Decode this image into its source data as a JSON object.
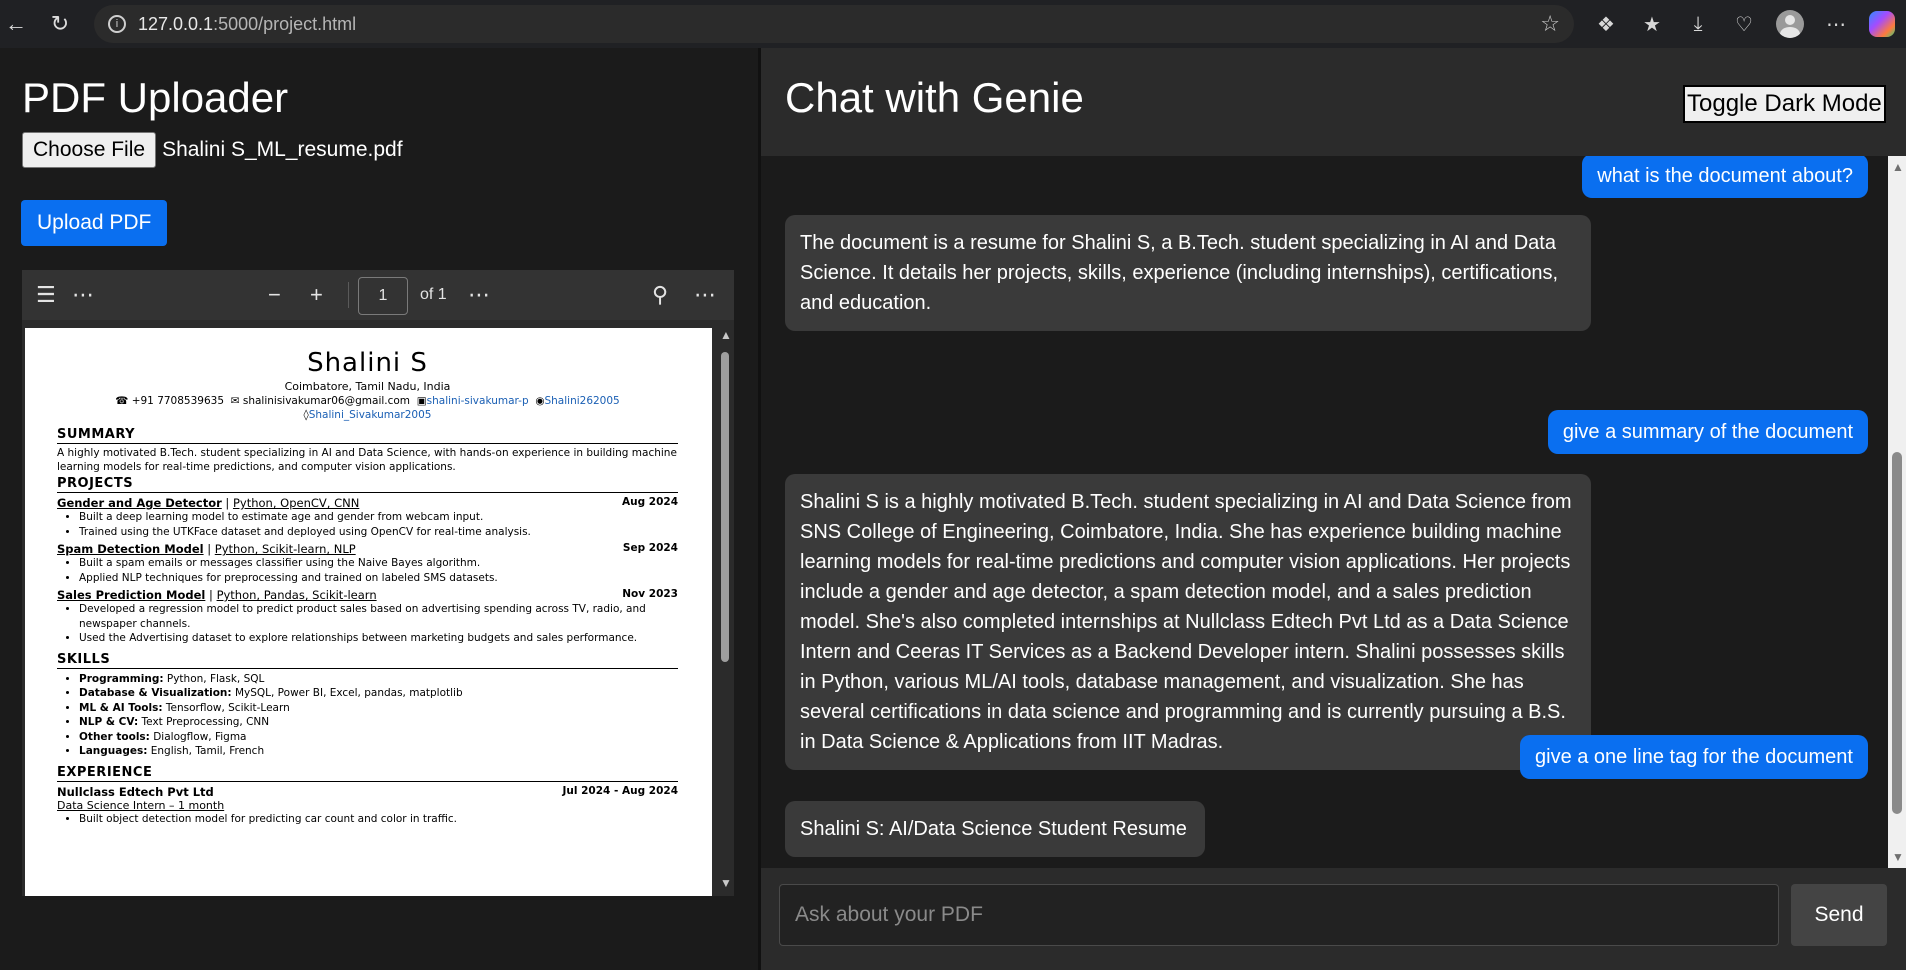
{
  "browser": {
    "url_host": "127.0.0.1",
    "url_rest": ":5000/project.html"
  },
  "left": {
    "title": "PDF Uploader",
    "choose_label": "Choose File",
    "file_name": "Shalini S_ML_resume.pdf",
    "upload_label": "Upload PDF"
  },
  "pdf_viewer": {
    "page_value": "1",
    "page_of": "of 1"
  },
  "resume": {
    "name": "Shalini S",
    "location": "Coimbatore, Tamil Nadu, India",
    "phone": "+91 7708539635",
    "email": "shalinisivakumar06@gmail.com",
    "linkedin": "shalini-sivakumar-p",
    "github": "Shalini262005",
    "kaggle": "Shalini_Sivakumar2005",
    "summary_heading": "SUMMARY",
    "summary_text": "A highly motivated B.Tech. student specializing in AI and Data Science, with hands-on experience in building machine learning models for real-time predictions, and computer vision applications.",
    "projects_heading": "PROJECTS",
    "projects": [
      {
        "title": "Gender and Age Detector",
        "tech": "Python, OpenCV, CNN",
        "date": "Aug 2024",
        "bullets": [
          "Built a deep learning model to estimate age and gender from webcam input.",
          "Trained using the UTKFace dataset and deployed using OpenCV for real-time analysis."
        ]
      },
      {
        "title": "Spam Detection Model",
        "tech": "Python, Scikit-learn, NLP",
        "date": "Sep 2024",
        "bullets": [
          "Built a spam emails or messages classifier using the Naive Bayes algorithm.",
          "Applied NLP techniques for preprocessing and trained on labeled SMS datasets."
        ]
      },
      {
        "title": "Sales Prediction Model",
        "tech": "Python, Pandas, Scikit-learn",
        "date": "Nov 2023",
        "bullets": [
          "Developed a regression model to predict product sales based on advertising spending across TV, radio, and newspaper channels.",
          "Used the Advertising dataset to explore relationships between marketing budgets and sales performance."
        ]
      }
    ],
    "skills_heading": "SKILLS",
    "skills": [
      {
        "label": "Programming:",
        "value": "Python, Flask, SQL"
      },
      {
        "label": "Database & Visualization:",
        "value": "MySQL, Power BI, Excel, pandas, matplotlib"
      },
      {
        "label": "ML & AI Tools:",
        "value": "Tensorflow, Scikit-Learn"
      },
      {
        "label": "NLP & CV:",
        "value": "Text Preprocessing, CNN"
      },
      {
        "label": "Other tools:",
        "value": "Dialogflow, Figma"
      },
      {
        "label": "Languages:",
        "value": "English, Tamil, French"
      }
    ],
    "experience_heading": "EXPERIENCE",
    "exp_company": "Nullclass Edtech Pvt Ltd",
    "exp_date": "Jul 2024 - Aug 2024",
    "exp_role": "Data Science Intern – 1 month",
    "exp_bullet": "Built object detection model for predicting car count and color in traffic."
  },
  "chat": {
    "title": "Chat with Genie",
    "toggle_label": "Toggle Dark Mode",
    "messages": [
      {
        "role": "user",
        "text": "what is the document about?"
      },
      {
        "role": "bot",
        "text": "The document is a resume for Shalini S, a B.Tech. student specializing in AI and Data Science. It details her projects, skills, experience (including internships), certifications, and education."
      },
      {
        "role": "user",
        "text": "give a summary of the document"
      },
      {
        "role": "bot",
        "text": "Shalini S is a highly motivated B.Tech. student specializing in AI and Data Science from SNS College of Engineering, Coimbatore, India. She has experience building machine learning models for real-time predictions and computer vision applications. Her projects include a gender and age detector, a spam detection model, and a sales prediction model. She's also completed internships at Nullclass Edtech Pvt Ltd as a Data Science Intern and Ceeras IT Services as a Backend Developer intern. Shalini possesses skills in Python, various ML/AI tools, database management, and visualization. She has several certifications in data science and programming and is currently pursuing a B.S. in Data Science & Applications from IIT Madras."
      },
      {
        "role": "user",
        "text": "give a one line tag for the document"
      },
      {
        "role": "bot",
        "text": "Shalini S: AI/Data Science Student Resume"
      }
    ],
    "input_placeholder": "Ask about your PDF",
    "send_label": "Send"
  }
}
